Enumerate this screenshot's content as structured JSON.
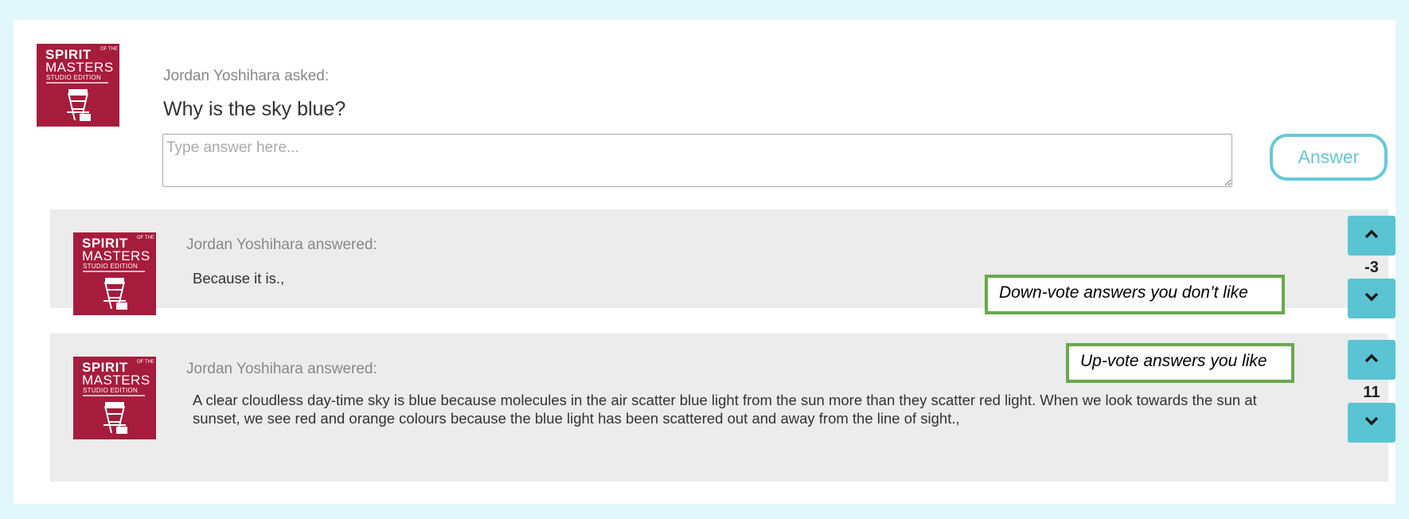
{
  "question": {
    "asker_label": "Jordan Yoshihara asked:",
    "text": "Why is the sky blue?",
    "input_placeholder": "Type answer here...",
    "answer_button": "Answer"
  },
  "avatar": {
    "line1": "SPIRIT",
    "line1_small": "OF THE",
    "line2": "MASTERS",
    "line3": "STUDIO EDITION"
  },
  "answers": [
    {
      "author_label": "Jordan Yoshihara answered:",
      "text": "Because it is.,",
      "votes": "-3",
      "callout": "Down-vote answers you don’t like"
    },
    {
      "author_label": "Jordan Yoshihara answered:",
      "text": "A clear cloudless day-time sky is blue because molecules in the air scatter blue light from the sun more than they scatter red light. When we look towards the sun at sunset, we see red and orange colours because the blue light has been scattered out and away from the line of sight.,",
      "votes": "11",
      "callout": "Up-vote answers you like"
    }
  ],
  "icons": {
    "upvote": "chevron-up-icon",
    "downvote": "chevron-down-icon"
  },
  "colors": {
    "accent": "#5bc4d2",
    "avatar_bg": "#a61c3c",
    "callout_border": "#6aa84f",
    "page_bg": "#e2f7fa"
  }
}
